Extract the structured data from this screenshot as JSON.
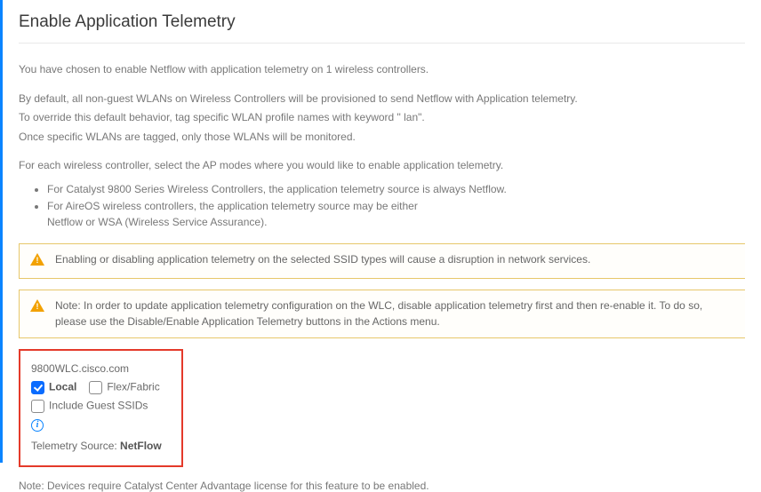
{
  "title": "Enable Application Telemetry",
  "intro": {
    "p1": "You have chosen to enable Netflow with application telemetry on 1 wireless controllers.",
    "p2a": "By default, all non-guest WLANs on Wireless Controllers will be provisioned to send Netflow with Application telemetry.",
    "p2b": "To override this default behavior, tag specific WLAN profile names with keyword \" lan\".",
    "p2c": "Once specific WLANs are tagged, only those WLANs will be monitored.",
    "p3": "For each wireless controller, select the AP modes where you would like to enable application telemetry."
  },
  "bullets": [
    "For Catalyst 9800 Series Wireless Controllers, the application telemetry source is always Netflow.",
    "For AireOS wireless controllers, the application telemetry source may be either",
    "Netflow or WSA (Wireless Service Assurance)."
  ],
  "alerts": {
    "a1": "Enabling or disabling application telemetry on the selected SSID types will cause a disruption in network services.",
    "a2": "Note: In order to update application telemetry configuration on the WLC, disable application telemetry first and then re-enable it. To do so, please use the Disable/Enable Application Telemetry buttons in the Actions menu."
  },
  "controller": {
    "hostname": "9800WLC.cisco.com",
    "local_label": "Local",
    "local_checked": true,
    "flex_label": "Flex/Fabric",
    "flex_checked": false,
    "guest_label": "Include Guest SSIDs",
    "guest_checked": false,
    "src_prefix": "Telemetry Source:",
    "src_value": "NetFlow"
  },
  "footnote": "Note: Devices require Catalyst Center Advantage license for this feature to be enabled.",
  "icons": {
    "info_glyph": "i"
  }
}
